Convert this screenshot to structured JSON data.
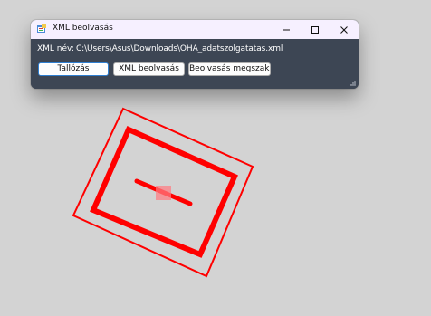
{
  "window": {
    "title": "XML beolvasás",
    "fields": {
      "xml_name_label": "XML név:",
      "xml_path_value": "C:\\Users\\Asus\\Downloads\\OHA_adatszolgatatas.xml"
    },
    "buttons": {
      "browse": "Tallózás",
      "read": "XML beolvasás",
      "cancel": "Beolvasás megszakítás"
    }
  },
  "icons": {
    "app": "xml-app-icon",
    "minimize": "minimize-icon",
    "maximize": "maximize-icon",
    "close": "close-icon",
    "resize_grip": "resize-grip-icon"
  },
  "colors": {
    "desktop_background": "#d3d3d3",
    "window_background": "#3d4654",
    "titlebar_background": "#f6f0ff",
    "drawing_red": "#ff0000",
    "button_focus_border": "#2f7fd1"
  }
}
